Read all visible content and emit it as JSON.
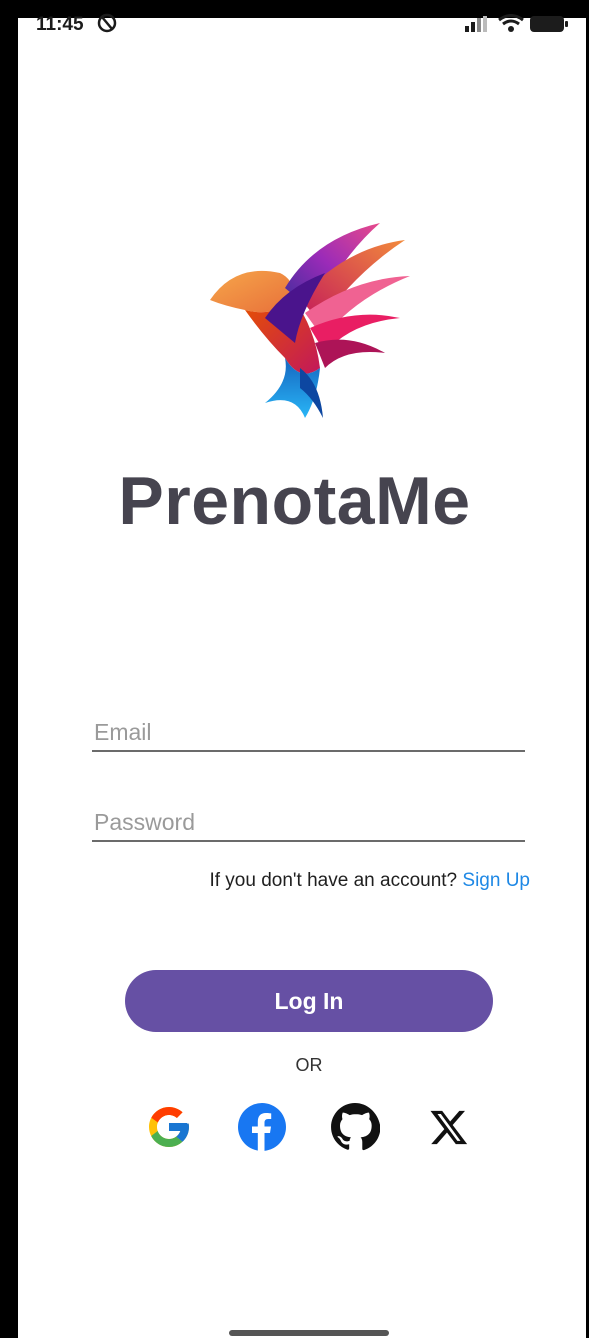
{
  "status_bar": {
    "time": "11:45"
  },
  "app": {
    "brand_name": "PrenotaMe"
  },
  "login_form": {
    "email_placeholder": "Email",
    "email_value": "",
    "password_placeholder": "Password",
    "password_value": "",
    "signup_prompt": "If you don't have an account?",
    "signup_link": "Sign Up",
    "login_button": "Log In",
    "or_label": "OR"
  },
  "social_logins": [
    {
      "name": "google-icon"
    },
    {
      "name": "facebook-icon"
    },
    {
      "name": "github-icon"
    },
    {
      "name": "x-icon"
    }
  ],
  "colors": {
    "primary": "#6650a4",
    "link": "#1e88e5",
    "brand_text": "#46444f",
    "facebook": "#1877f2"
  }
}
